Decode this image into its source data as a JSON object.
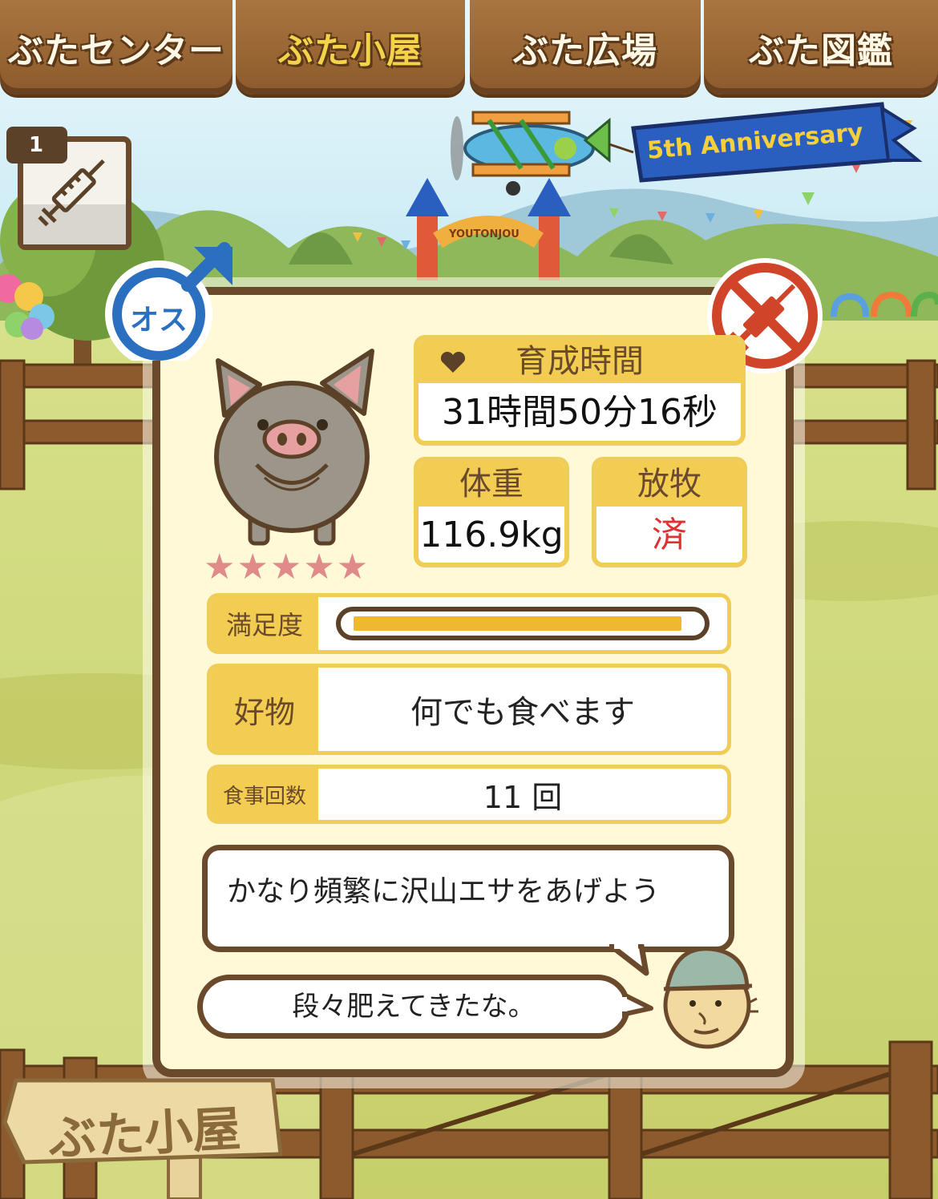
{
  "nav": {
    "tabs": [
      {
        "label": "ぶたセンター",
        "active": false
      },
      {
        "label": "ぶた小屋",
        "active": true
      },
      {
        "label": "ぶた広場",
        "active": false
      },
      {
        "label": "ぶた図鑑",
        "active": false
      }
    ]
  },
  "banner": {
    "anniversary": "5th Anniversary",
    "gate_sign": "YOUTONJOU"
  },
  "injection": {
    "count": "1"
  },
  "pig": {
    "gender_label": "オス",
    "rating_stars": 5,
    "star_glyph": "★★★★★"
  },
  "stats": {
    "growth_time": {
      "label": "育成時間",
      "value": "31時間50分16秒"
    },
    "weight": {
      "label": "体重",
      "value": "116.9kg"
    },
    "grazing": {
      "label": "放牧",
      "value": "済"
    }
  },
  "rows": {
    "satisfaction": {
      "label": "満足度",
      "level": 0.97
    },
    "favorite_food": {
      "label": "好物",
      "value": "何でも食べます"
    },
    "meal_count": {
      "label": "食事回数",
      "value": "11 回"
    }
  },
  "advice": {
    "text": "かなり頻繁に沢山エサをあげよう"
  },
  "comment": {
    "text": "段々肥えてきたな。"
  },
  "sign": {
    "label": "ぶた小屋"
  },
  "colors": {
    "wood": "#8c5a2c",
    "card_border": "#6b4a2c",
    "accent_yellow": "#f2cd52",
    "grazing_done": "#e03030",
    "gender_blue": "#2a6fc0",
    "no_injection_red": "#d0452a"
  }
}
